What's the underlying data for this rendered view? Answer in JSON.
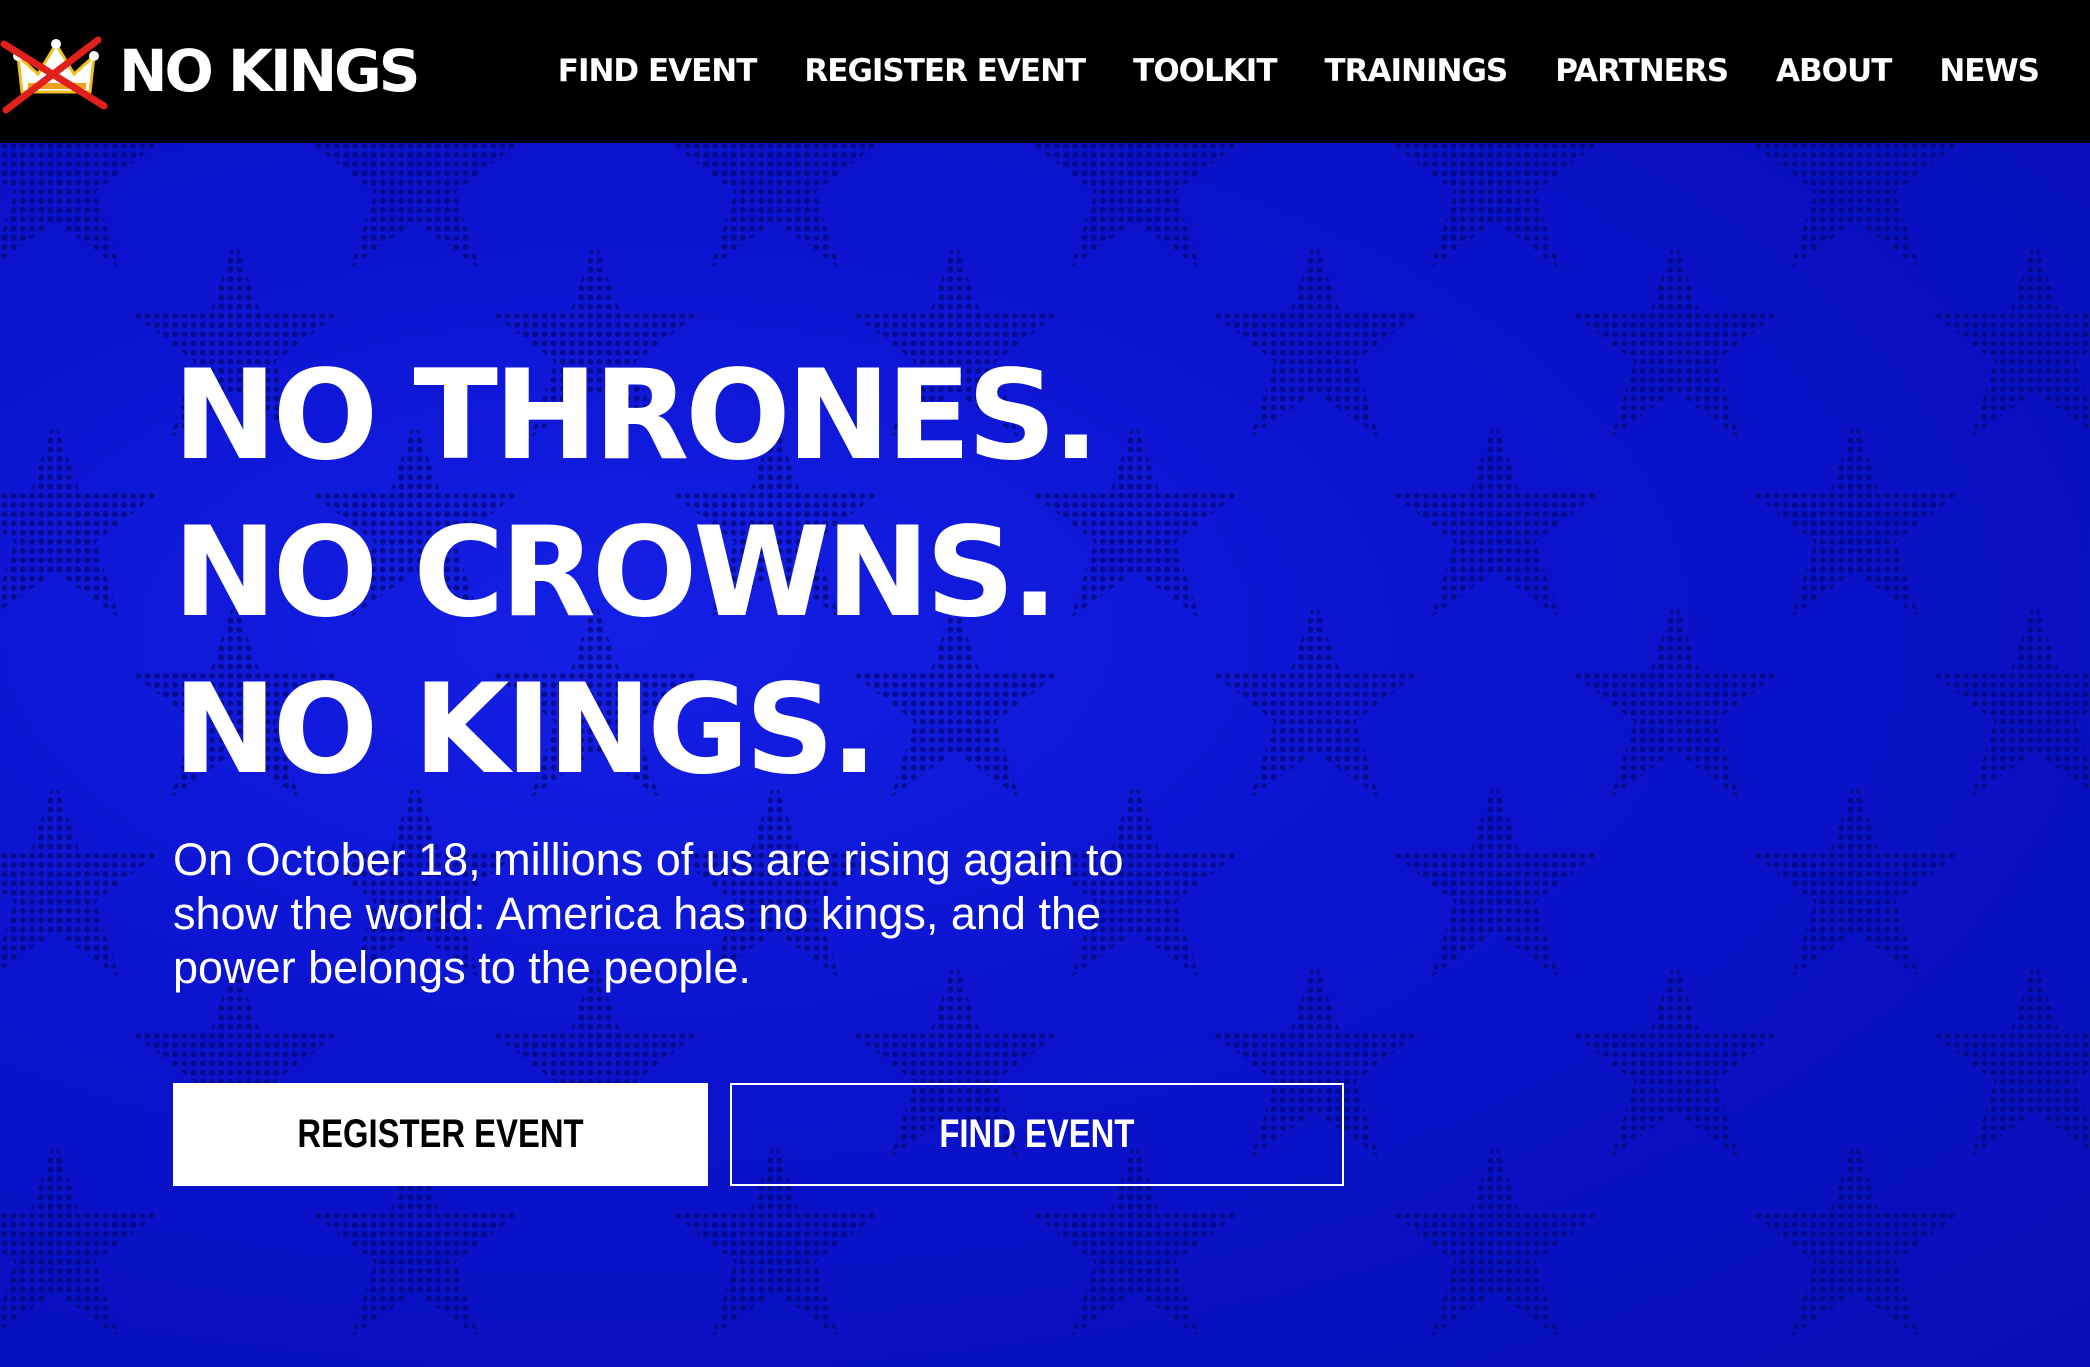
{
  "header": {
    "logo": {
      "text": "NO KINGS",
      "icon": "crossed-out-crown-icon"
    },
    "nav": [
      {
        "label": "FIND EVENT"
      },
      {
        "label": "REGISTER EVENT"
      },
      {
        "label": "TOOLKIT"
      },
      {
        "label": "TRAININGS"
      },
      {
        "label": "PARTNERS"
      },
      {
        "label": "ABOUT"
      },
      {
        "label": "NEWS"
      }
    ]
  },
  "hero": {
    "headline": [
      "NO THRONES.",
      "NO CROWNS.",
      "NO KINGS."
    ],
    "subtext": "On October 18, millions of us are rising again to show the world: America has no kings, and the power belongs to the people.",
    "buttons": {
      "primary": "REGISTER EVENT",
      "secondary": "FIND EVENT"
    }
  },
  "colors": {
    "header_bg": "#000000",
    "hero_bg": "#0a12cc",
    "star_pattern": "#050a78",
    "text": "#ffffff",
    "accent_red": "#e0211b"
  }
}
